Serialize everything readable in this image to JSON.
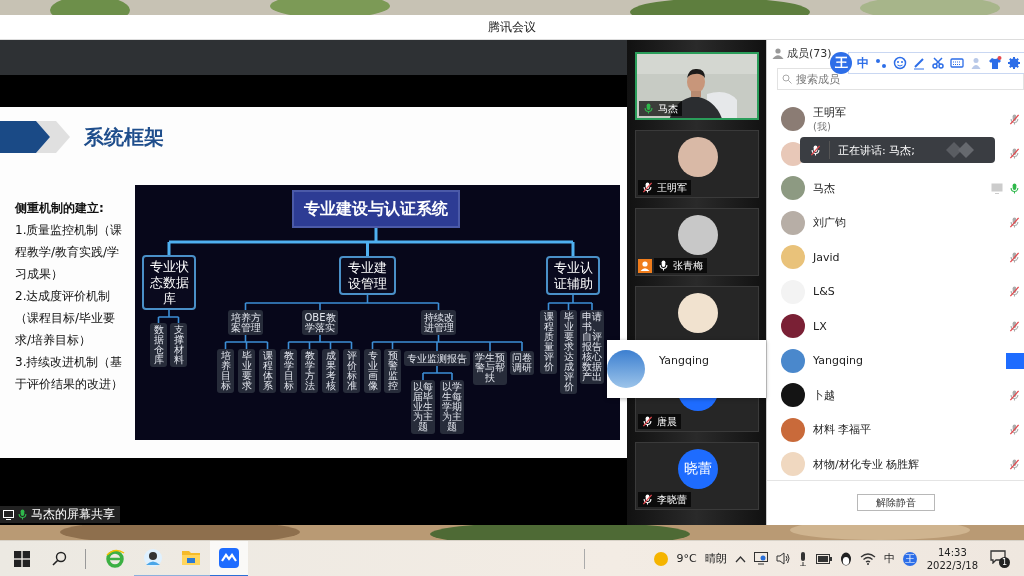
{
  "window": {
    "title": "腾讯会议"
  },
  "share": {
    "heading": "系统框架",
    "intro_title": "侧重机制的建立:",
    "intro_items": [
      "1.质量监控机制（课程教学/教育实践/学习成果）",
      "2.达成度评价机制（课程目标/毕业要求/培养目标）",
      "3.持续改进机制（基于评价结果的改进）"
    ],
    "diagram": {
      "label": "专业建设与认证系统",
      "children": [
        {
          "label": "专业状态数据库",
          "children": [
            {
              "label": "数据仓库"
            },
            {
              "label": "支撑材料"
            }
          ]
        },
        {
          "label": "专业建设管理",
          "children": [
            {
              "label": "培养方案管理",
              "children": [
                {
                  "label": "培养目标"
                },
                {
                  "label": "毕业要求"
                },
                {
                  "label": "课程体系"
                }
              ]
            },
            {
              "label": "OBE教学落实",
              "children": [
                {
                  "label": "教学目标"
                },
                {
                  "label": "教学方法"
                },
                {
                  "label": "成果考核"
                },
                {
                  "label": "评价标准"
                }
              ]
            },
            {
              "label": "持续改进管理",
              "children": [
                {
                  "label": "专业画像"
                },
                {
                  "label": "预警监控"
                },
                {
                  "label": "专业监测报告",
                  "children": [
                    {
                      "label": "以每届毕业生为主题"
                    },
                    {
                      "label": "以学生每学期为主题"
                    }
                  ]
                },
                {
                  "label": "学生预警与帮扶"
                },
                {
                  "label": "问卷调研"
                }
              ]
            }
          ]
        },
        {
          "label": "专业认证辅助",
          "children": [
            {
              "label": "课程质量评价"
            },
            {
              "label": "毕业要求达成评价"
            },
            {
              "label": "申请书、自评报告核心数据产出"
            }
          ]
        }
      ]
    },
    "label": "马杰的屏幕共享",
    "muted": false,
    "speaking": true
  },
  "video_tiles": [
    {
      "kind": "video",
      "name": "马杰",
      "muted": false,
      "speaking": true,
      "highlighted": true,
      "host_badge": false
    },
    {
      "kind": "avatar",
      "name": "王明军",
      "muted": true,
      "speaking": false,
      "highlighted": false,
      "host_badge": false
    },
    {
      "kind": "avatar",
      "name": "张青梅",
      "muted": false,
      "speaking": false,
      "highlighted": false,
      "host_badge": true
    },
    {
      "kind": "avatar",
      "highlighted": false
    },
    {
      "kind": "avatar",
      "name": "唐晨",
      "muted": true,
      "speaking": false,
      "highlighted": false,
      "host_badge": false
    },
    {
      "kind": "initials",
      "initials": "晓蕾",
      "name": "李晓蕾",
      "muted": true,
      "speaking": false,
      "highlighted": false,
      "host_badge": false
    }
  ],
  "popup": {
    "name": "Yangqing"
  },
  "members": {
    "title": "成员(73)",
    "search_placeholder": "搜索成员",
    "rows": [
      {
        "name": "王明军",
        "note": "(我)",
        "muted": true,
        "speaking": false,
        "sharing": false,
        "hovered": false
      },
      {
        "muted": true,
        "speaking": false,
        "sharing": false,
        "hovered": false
      },
      {
        "name": "马杰",
        "muted": false,
        "speaking": true,
        "sharing": true,
        "hovered": false
      },
      {
        "name": "刘广钧",
        "muted": true,
        "speaking": false,
        "sharing": false,
        "hovered": false
      },
      {
        "name": "Javid",
        "muted": true,
        "speaking": false,
        "sharing": false,
        "hovered": false
      },
      {
        "name": "L&S",
        "muted": true,
        "speaking": false,
        "sharing": false,
        "hovered": false
      },
      {
        "name": "LX",
        "muted": true,
        "speaking": false,
        "sharing": false,
        "hovered": false
      },
      {
        "name": "Yangqing",
        "sharing": false,
        "hovered": true
      },
      {
        "name": "卜越",
        "muted": true,
        "speaking": false,
        "sharing": false,
        "hovered": false
      },
      {
        "name": "材料 李福平",
        "muted": true,
        "speaking": false,
        "sharing": false,
        "hovered": false
      },
      {
        "name": "材物/材化专业 杨胜辉",
        "muted": true,
        "speaking": false,
        "sharing": false,
        "hovered": false
      }
    ],
    "unmute_button": "解除静音"
  },
  "tooltip": {
    "text": "正在讲话: 马杰;",
    "muted": true,
    "speaking": false
  },
  "ime_toolbar": {
    "logo": "王",
    "mode": "中"
  },
  "taskbar": {
    "apps": [
      {
        "kind": "browser",
        "running": false,
        "selected": false
      },
      {
        "kind": "person",
        "running": true,
        "selected": false
      },
      {
        "kind": "folder",
        "running": true,
        "selected": false
      },
      {
        "kind": "meeting",
        "running": true,
        "selected": true
      }
    ],
    "temperature": "9°C",
    "condition": "晴朗",
    "ime": "中",
    "ime_logo": "王",
    "time": "14:33",
    "date": "2022/3/18",
    "notifications": "1"
  }
}
